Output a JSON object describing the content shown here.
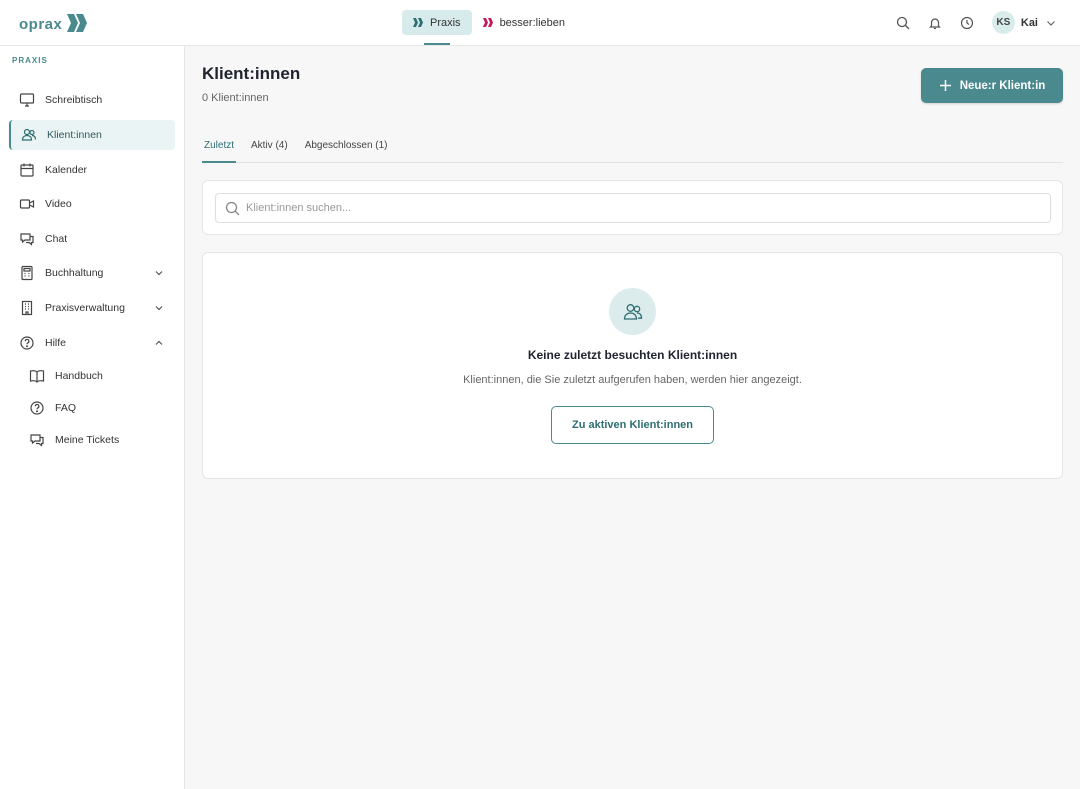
{
  "brand": {
    "name": "oprax",
    "accent": "#4a8a8e"
  },
  "apps": [
    {
      "label": "Praxis",
      "icon": "praxis-logo-icon",
      "active": true
    },
    {
      "label": "besser:lieben",
      "icon": "besser-lieben-logo-icon",
      "active": false
    }
  ],
  "topbar": {
    "icons": [
      "search-icon",
      "bell-icon",
      "clock-icon"
    ],
    "user": {
      "initials": "KS",
      "name": "Kai"
    }
  },
  "sidebar": {
    "heading": "PRAXIS",
    "items": [
      {
        "label": "Schreibtisch",
        "icon": "monitor-icon"
      },
      {
        "label": "Klient:innen",
        "icon": "users-icon",
        "active": true
      },
      {
        "label": "Kalender",
        "icon": "calendar-icon"
      },
      {
        "label": "Video",
        "icon": "video-icon"
      },
      {
        "label": "Chat",
        "icon": "chat-icon"
      },
      {
        "label": "Buchhaltung",
        "icon": "calculator-icon",
        "expand": "chevron-down"
      },
      {
        "label": "Praxisverwaltung",
        "icon": "building-icon",
        "expand": "chevron-down"
      },
      {
        "label": "Hilfe",
        "icon": "help-circle-icon",
        "expand": "chevron-up"
      }
    ],
    "help_items": [
      {
        "label": "Handbuch",
        "icon": "book-icon"
      },
      {
        "label": "FAQ",
        "icon": "question-icon"
      },
      {
        "label": "Meine Tickets",
        "icon": "tickets-icon"
      }
    ]
  },
  "main": {
    "title": "Klient:innen",
    "subtitle": "0 Klient:innen",
    "new_button": "Neue:r Klient:in",
    "tabs": [
      {
        "label": "Zuletzt",
        "active": true
      },
      {
        "label": "Aktiv (4)"
      },
      {
        "label": "Abgeschlossen (1)"
      }
    ],
    "search": {
      "placeholder": "Klient:innen suchen...",
      "value": ""
    },
    "empty": {
      "title": "Keine zuletzt besuchten Klient:innen",
      "description": "Klient:innen, die Sie zuletzt aufgerufen haben, werden hier angezeigt.",
      "button": "Zu aktiven Klient:innen"
    }
  }
}
